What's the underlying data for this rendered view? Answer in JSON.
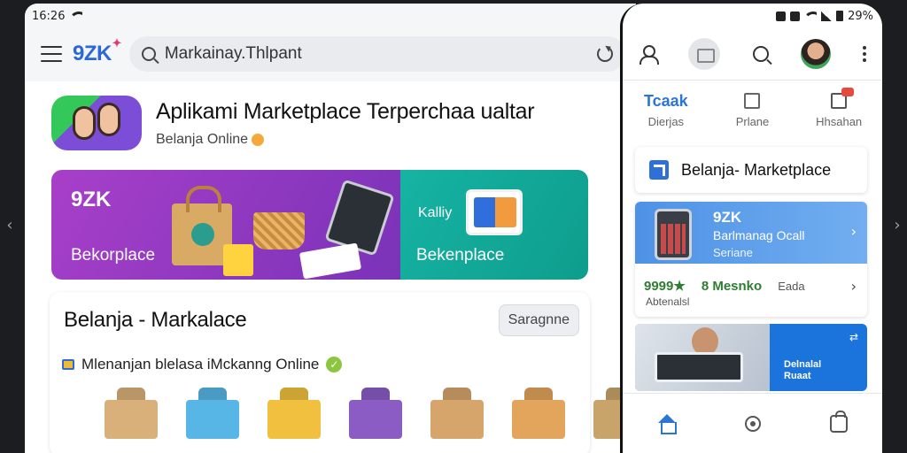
{
  "tablet": {
    "status": {
      "time": "16:26"
    },
    "browser": {
      "brand": "9ZK",
      "search_text": "Markainay.Thlpant"
    },
    "app": {
      "title": "Aplikami Marketplace Terperchaa ualtar",
      "subtitle": "Belanja Online"
    },
    "banner": {
      "brand": "9ZK",
      "left_label": "Bekorplace",
      "right_text": "Kalliy",
      "right_label": "Bekenplace"
    },
    "section": {
      "title": "Belanja - Markalace",
      "button": "Saragnne",
      "subtitle": "Mlenanjan blelasa iMckanng Online"
    },
    "products": [
      {
        "name": "box-1",
        "color": "#d9b07a"
      },
      {
        "name": "box-2",
        "color": "#57b6e6"
      },
      {
        "name": "box-3",
        "color": "#f0c03e"
      },
      {
        "name": "box-4",
        "color": "#8a5cc4"
      },
      {
        "name": "box-5",
        "color": "#d6a56c"
      },
      {
        "name": "box-6",
        "color": "#e3a45c"
      },
      {
        "name": "box-7",
        "color": "#c9a46a"
      }
    ]
  },
  "phone": {
    "status": {
      "battery": "29%"
    },
    "tabs": [
      {
        "icon": "Tcaak",
        "label": "Dierjas"
      },
      {
        "icon": "image-icon",
        "label": "Prlane"
      },
      {
        "icon": "note-icon",
        "label": "Hhsahan"
      }
    ],
    "card1": {
      "label": "Belanja- Marketplace"
    },
    "card2": {
      "brand": "9ZK",
      "line1": "Barlmanag Ocall",
      "line2": "Seriane",
      "stat_a": "9999★",
      "stat_b": "8 Mesnko",
      "stat_c": "Eada",
      "footer": "Abtenalsl"
    },
    "card3": {
      "line1": "Delnalal",
      "line2": "Ruaat"
    }
  },
  "colors": {
    "accent": "#2b76d2",
    "banner_purple": "#a83fc9",
    "banner_teal": "#16b3a3"
  }
}
